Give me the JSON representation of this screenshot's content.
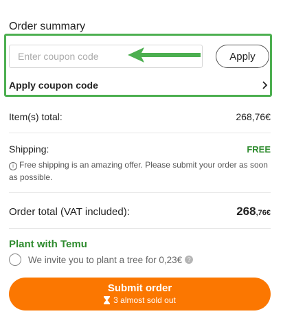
{
  "summary": {
    "title": "Order summary",
    "coupon_placeholder": "Enter coupon code",
    "apply_button": "Apply",
    "apply_coupon_link": "Apply coupon code"
  },
  "items_total": {
    "label": "Item(s) total:",
    "value": "268,76€"
  },
  "shipping": {
    "label": "Shipping:",
    "value": "FREE",
    "note": "Free shipping is an amazing offer. Please submit your order as soon as possible."
  },
  "order_total": {
    "label": "Order total (VAT included):",
    "integer": "268",
    "decimal": ",76€"
  },
  "plant": {
    "title": "Plant with Temu",
    "text": "We invite you to plant a tree for 0,23€"
  },
  "submit": {
    "label": "Submit order",
    "sub": "3 almost sold out"
  },
  "colors": {
    "accent": "#fb7701",
    "green": "#2e8b2e",
    "highlight": "#4caf50"
  },
  "icons": [
    "arrow-left-icon",
    "chevron-right-icon",
    "info-icon",
    "help-icon",
    "hourglass-icon"
  ]
}
